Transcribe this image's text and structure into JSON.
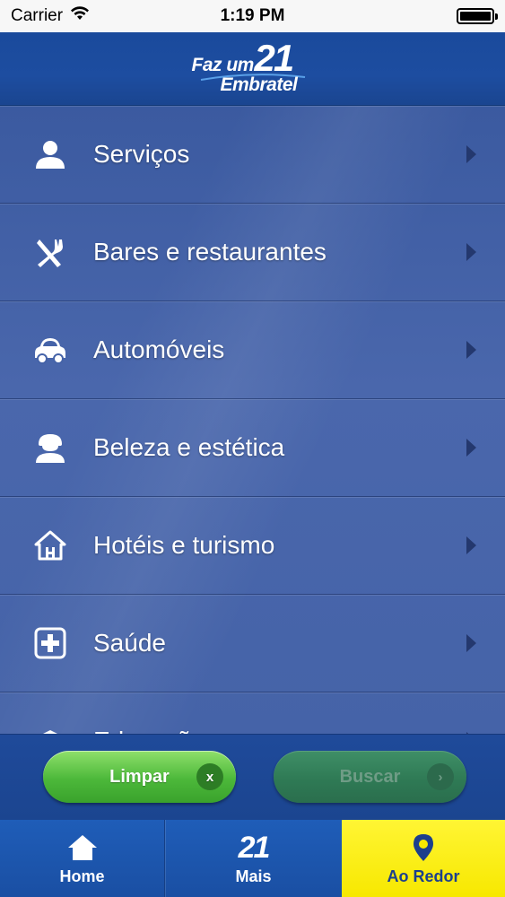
{
  "status_bar": {
    "carrier": "Carrier",
    "time": "1:19 PM"
  },
  "header": {
    "logo_top": "Faz um",
    "logo_number": "21",
    "logo_bottom": "Embratel"
  },
  "categories": [
    {
      "label": "Serviços",
      "icon": "person-icon"
    },
    {
      "label": "Bares e restaurantes",
      "icon": "fork-knife-icon"
    },
    {
      "label": "Automóveis",
      "icon": "car-icon"
    },
    {
      "label": "Beleza e estética",
      "icon": "beauty-person-icon"
    },
    {
      "label": "Hotéis e turismo",
      "icon": "house-icon"
    },
    {
      "label": "Saúde",
      "icon": "health-plus-icon"
    },
    {
      "label": "Educação",
      "icon": "education-icon"
    }
  ],
  "actions": {
    "clear_label": "Limpar",
    "clear_badge": "x",
    "search_label": "Buscar",
    "search_badge": "›"
  },
  "tabs": [
    {
      "label": "Home",
      "icon": "home-icon"
    },
    {
      "label": "Mais",
      "icon": "21-logo-icon",
      "icon_text": "21"
    },
    {
      "label": "Ao Redor",
      "icon": "location-pin-icon",
      "selected": true
    }
  ],
  "colors": {
    "header_blue": "#1a4a9c",
    "list_blue": "#4563a8",
    "button_green": "#4cb83a",
    "selected_tab_yellow": "#f7e800"
  }
}
